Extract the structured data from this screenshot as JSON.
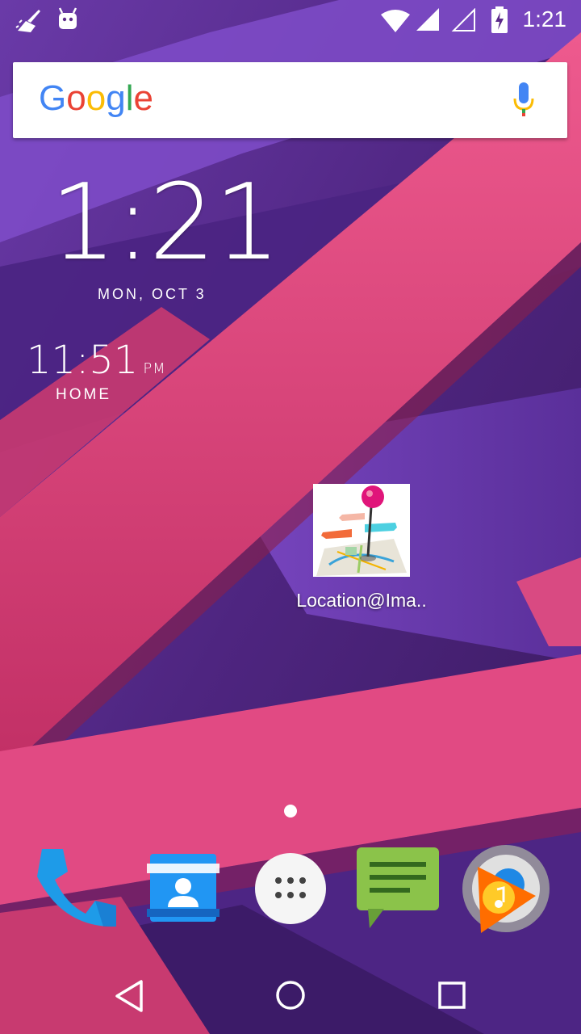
{
  "status_bar": {
    "time": "1:21",
    "icons": [
      "cleaner-icon",
      "android-icon",
      "wifi-icon",
      "signal-icon",
      "signal-empty-icon",
      "battery-charging-icon"
    ]
  },
  "search": {
    "logo_letters": [
      "G",
      "o",
      "o",
      "g",
      "l",
      "e"
    ],
    "mic_icon": "mic-icon"
  },
  "clock_widget": {
    "time": "1:21",
    "date": "MON, OCT 3",
    "world_time": "11:51",
    "world_ampm": "PM",
    "world_city": "HOME"
  },
  "home_apps": [
    {
      "label": "Location@Ima..",
      "icon": "location-pin-map-icon"
    }
  ],
  "dock": {
    "items": [
      "phone-icon",
      "contacts-icon",
      "app-drawer-icon",
      "messaging-icon",
      "play-music-icon"
    ]
  },
  "nav_bar": {
    "items": [
      "back-icon",
      "home-icon",
      "recents-icon"
    ]
  },
  "colors": {
    "wallpaper_pink": "#d63f77",
    "wallpaper_purple": "#5b2a8a",
    "phone_blue": "#1e9be8",
    "contacts_blue": "#2196f3",
    "messaging_green": "#8bc34a",
    "pin_magenta": "#e0157a"
  }
}
